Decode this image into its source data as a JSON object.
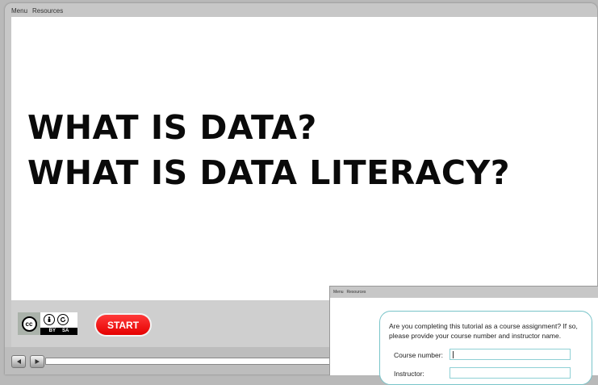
{
  "menubar": {
    "items": [
      "Menu",
      "Resources"
    ]
  },
  "slide": {
    "title_lines": [
      "WHAT IS DATA?",
      "WHAT IS DATA LITERACY?"
    ]
  },
  "license": {
    "cc": "cc",
    "labels": [
      "BY",
      "SA"
    ]
  },
  "controls": {
    "start_label": "START"
  },
  "overlay": {
    "menubar": [
      "Menu",
      "Resources"
    ],
    "question": "Are you completing this tutorial as a course assignment? If so, please provide your course number and instructor name.",
    "course_label": "Course number:",
    "instructor_label": "Instructor:",
    "course_value": "",
    "instructor_value": ""
  }
}
